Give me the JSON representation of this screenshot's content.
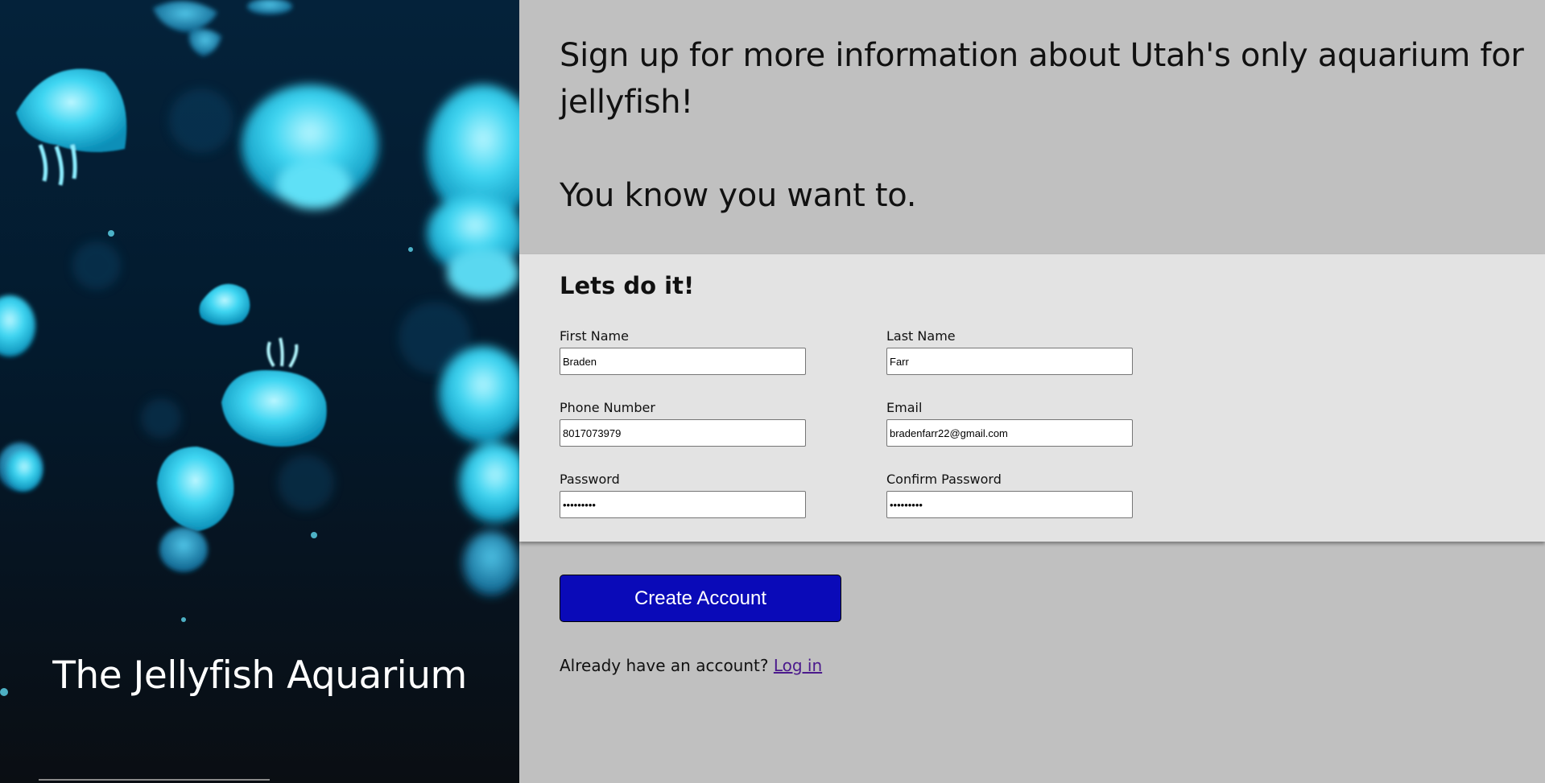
{
  "hero": {
    "title": "The Jellyfish Aquarium"
  },
  "intro": {
    "line1": "Sign up for more information about Utah's only aquarium for jellyfish!",
    "line2": "You know you want to."
  },
  "form": {
    "heading": "Lets do it!",
    "fields": {
      "first_name": {
        "label": "First Name",
        "value": "Braden"
      },
      "last_name": {
        "label": "Last Name",
        "value": "Farr"
      },
      "phone": {
        "label": "Phone Number",
        "value": "8017073979"
      },
      "email": {
        "label": "Email",
        "value": "bradenfarr22@gmail.com"
      },
      "password": {
        "label": "Password",
        "value": "•••••••••"
      },
      "confirm_password": {
        "label": "Confirm Password",
        "value": "•••••••••"
      }
    },
    "submit_label": "Create Account",
    "login_prompt": "Already have an account?",
    "login_link": "Log in"
  },
  "colors": {
    "button_bg": "#0a0ab8",
    "form_bg": "#e3e3e3",
    "page_bg": "#c0c0c0",
    "link": "#4b1a8c",
    "jelly": "#3fd6f2"
  }
}
